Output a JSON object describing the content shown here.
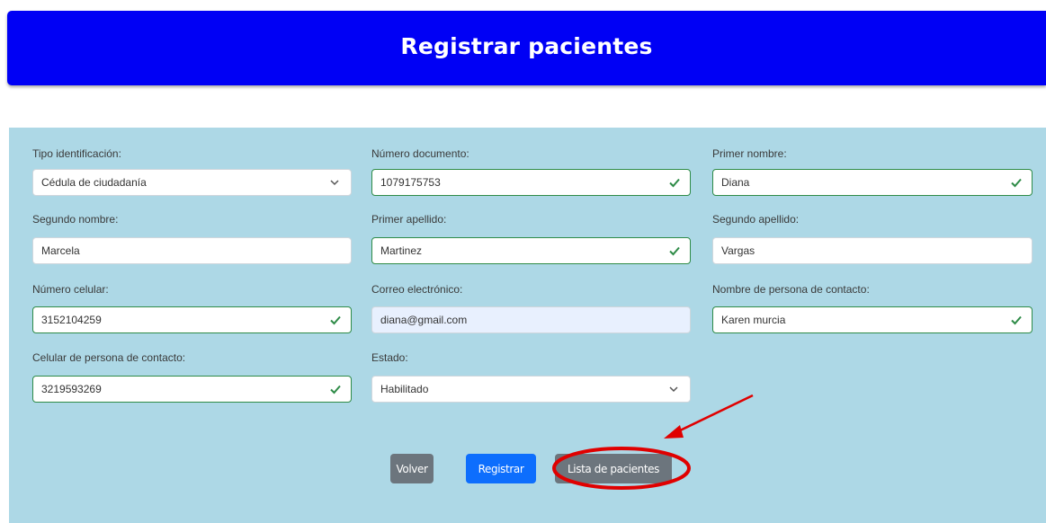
{
  "header": {
    "title": "Registrar pacientes"
  },
  "form": {
    "tipo_identificacion": {
      "label": "Tipo identificación:",
      "value": "Cédula de ciudadanía"
    },
    "numero_documento": {
      "label": "Número documento:",
      "value": "1079175753"
    },
    "primer_nombre": {
      "label": "Primer nombre:",
      "value": "Diana"
    },
    "segundo_nombre": {
      "label": "Segundo nombre:",
      "value": "Marcela"
    },
    "primer_apellido": {
      "label": "Primer apellido:",
      "value": "Martinez"
    },
    "segundo_apellido": {
      "label": "Segundo apellido:",
      "value": "Vargas"
    },
    "numero_celular": {
      "label": "Número celular:",
      "value": "3152104259"
    },
    "correo": {
      "label": "Correo electrónico:",
      "value": "diana@gmail.com"
    },
    "nombre_contacto": {
      "label": "Nombre de persona de contacto:",
      "value": "Karen murcia"
    },
    "celular_contacto": {
      "label": "Celular de persona de contacto:",
      "value": "3219593269"
    },
    "estado": {
      "label": "Estado:",
      "value": "Habilitado"
    }
  },
  "buttons": {
    "volver": "Volver",
    "registrar": "Registrar",
    "lista": "Lista de pacientes"
  },
  "colors": {
    "header_bg": "#0000f5",
    "panel_bg": "#add8e6",
    "valid_check": "#2e8b47",
    "annotation": "#e00000"
  },
  "icons": {
    "valid": "check-icon",
    "select": "chevron-down-icon"
  }
}
